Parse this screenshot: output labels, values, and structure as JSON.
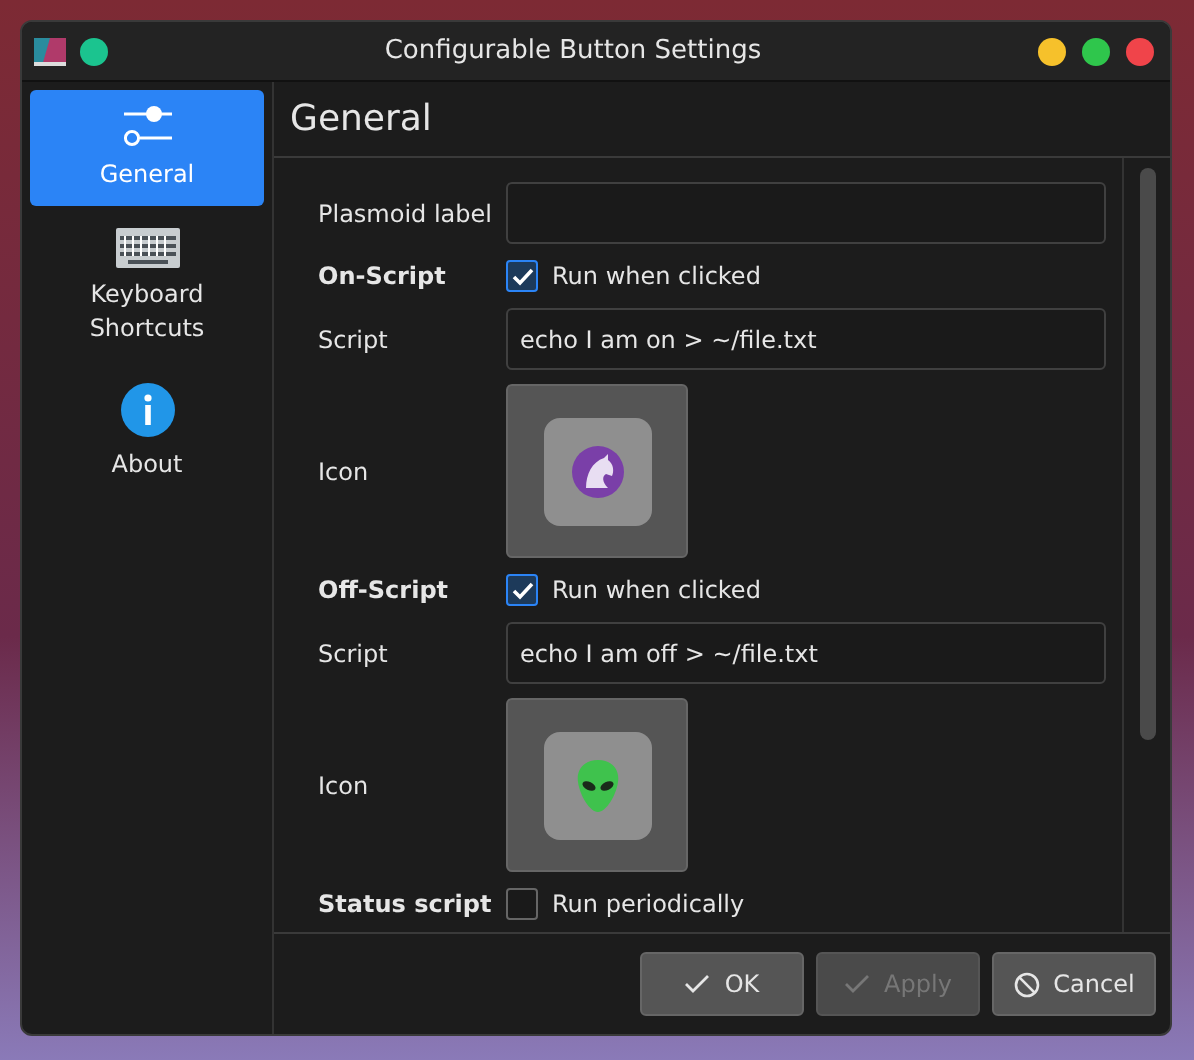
{
  "window": {
    "title": "Configurable Button Settings"
  },
  "sidebar": {
    "items": [
      {
        "label": "General",
        "selected": true
      },
      {
        "label": "Keyboard Shortcuts",
        "selected": false
      },
      {
        "label": "About",
        "selected": false
      }
    ]
  },
  "page": {
    "title": "General"
  },
  "form": [
    {
      "kind": "field",
      "label": "Plasmoid label"
    },
    {
      "kind": "check",
      "label": "On-Script",
      "text": "Run when clicked",
      "checked": true
    },
    {
      "kind": "field",
      "label": "Script",
      "value": "echo I am on > ~/file.txt"
    },
    {
      "kind": "icon",
      "label": "Icon"
    },
    {
      "kind": "check",
      "label": "Off-Script",
      "text": "Run when clicked",
      "checked": true
    },
    {
      "kind": "field",
      "label": "Script",
      "value": "echo I am off > ~/file.txt"
    },
    {
      "kind": "icon",
      "label": "Icon"
    },
    {
      "kind": "check",
      "label": "Status script",
      "text": "Run periodically",
      "checked": false
    }
  ],
  "buttons": [
    {
      "label": "OK",
      "disabled": false
    },
    {
      "label": "Apply",
      "disabled": true
    },
    {
      "label": "Cancel",
      "disabled": false
    }
  ]
}
